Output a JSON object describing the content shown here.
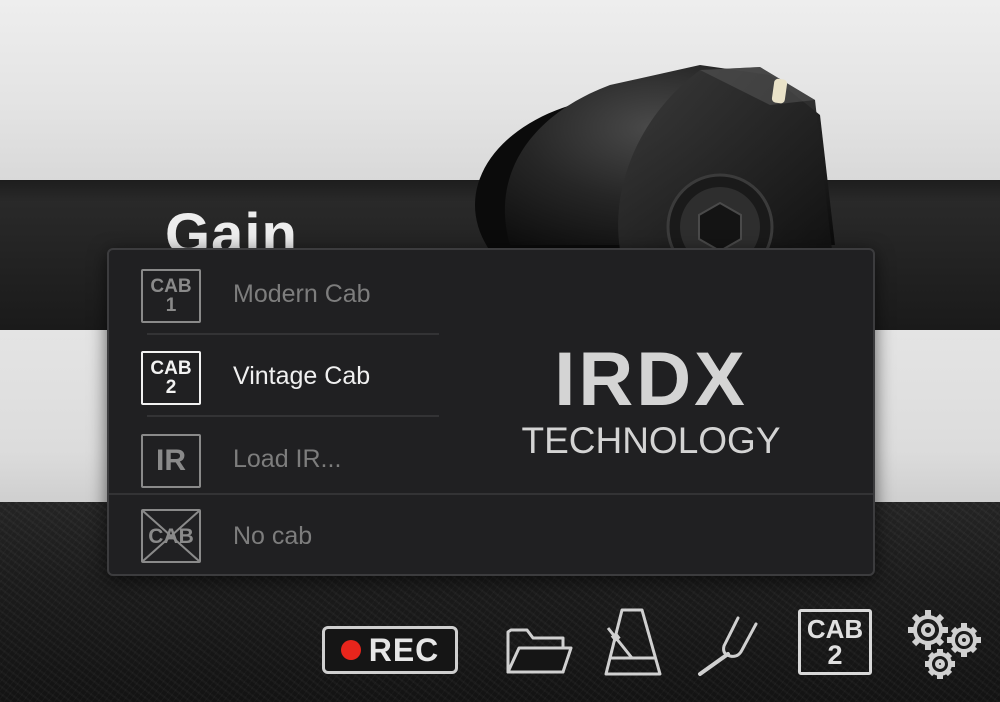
{
  "background": {
    "knob_label": "Gain"
  },
  "cab_menu": {
    "items": [
      {
        "icon_line1": "CAB",
        "icon_line2": "1",
        "icon_name": "cab-1-icon",
        "label": "Modern Cab",
        "state": "inactive"
      },
      {
        "icon_line1": "CAB",
        "icon_line2": "2",
        "icon_name": "cab-2-icon",
        "label": "Vintage Cab",
        "state": "selected"
      },
      {
        "icon_text": "IR",
        "icon_name": "ir-icon",
        "label": "Load IR...",
        "state": "inactive"
      },
      {
        "icon_text": "CAB",
        "icon_name": "no-cab-icon",
        "label": "No cab",
        "state": "inactive"
      }
    ],
    "logo": {
      "main": "IRDX",
      "sub": "TECHNOLOGY"
    }
  },
  "toolbar": {
    "rec_label": "REC",
    "cab_line1": "CAB",
    "cab_line2": "2",
    "icons": [
      "record-icon",
      "folder-icon",
      "metronome-icon",
      "tuning-fork-icon",
      "cab-2-icon",
      "settings-gears-icon"
    ]
  },
  "colors": {
    "menu_bg": "#202022",
    "selected_text": "#f0f0f0",
    "inactive_text": "#7d7d7d",
    "rec_dot": "#e8251c"
  }
}
